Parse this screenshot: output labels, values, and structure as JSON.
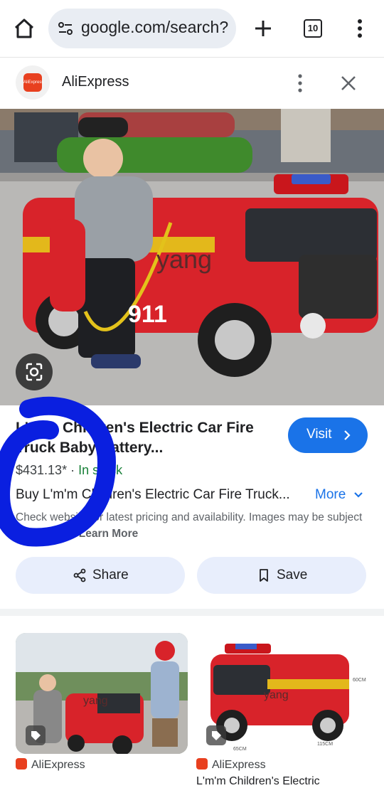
{
  "browser": {
    "url": "google.com/search?",
    "tab_count": "10"
  },
  "source": {
    "name": "AliExpress",
    "logo_text": "AliExpress"
  },
  "image": {
    "watermark": "yang",
    "truck_number": "911"
  },
  "product": {
    "title": "L'm'm Children's Electric Car Fire Truck Baby Battery...",
    "price": "$431.13*",
    "separator": "·",
    "stock": "In stock",
    "description": "Buy L'm'm Children's Electric Car Fire Truck...",
    "more_label": "More",
    "disclaimer": "Check website for latest pricing and availability. Images may be subject to copyright.",
    "learn_more": "Learn More",
    "visit_label": "Visit"
  },
  "actions": {
    "share_label": "Share",
    "save_label": "Save"
  },
  "related": [
    {
      "source": "AliExpress",
      "title": "AliExpress"
    },
    {
      "source": "AliExpress",
      "title": "L'm'm Children's Electric"
    }
  ],
  "related_watermarks": [
    "yang",
    "yang"
  ],
  "dimension_labels": [
    "60CM",
    "115CM",
    "65CM"
  ],
  "colors": {
    "accent": "#1a73e8",
    "stock": "#188038",
    "pill_bg": "#e8eefc",
    "truck_red": "#d8232a",
    "scribble": "#0a1fe0"
  }
}
